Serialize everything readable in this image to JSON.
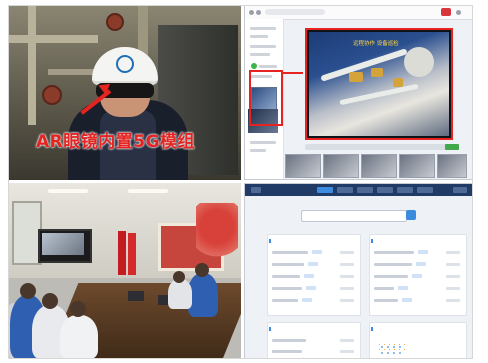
{
  "photo_ar": {
    "caption": "AR眼镜内置5G模组"
  },
  "remote_assist": {
    "video_overlay_text": "远程协作 设备巡检"
  },
  "dashboard": {
    "card_titles": [
      "",
      "",
      "",
      ""
    ]
  },
  "colors": {
    "annotation_red": "#e52421",
    "dashboard_nav": "#1f3b66",
    "accent_blue": "#3b8cde"
  }
}
